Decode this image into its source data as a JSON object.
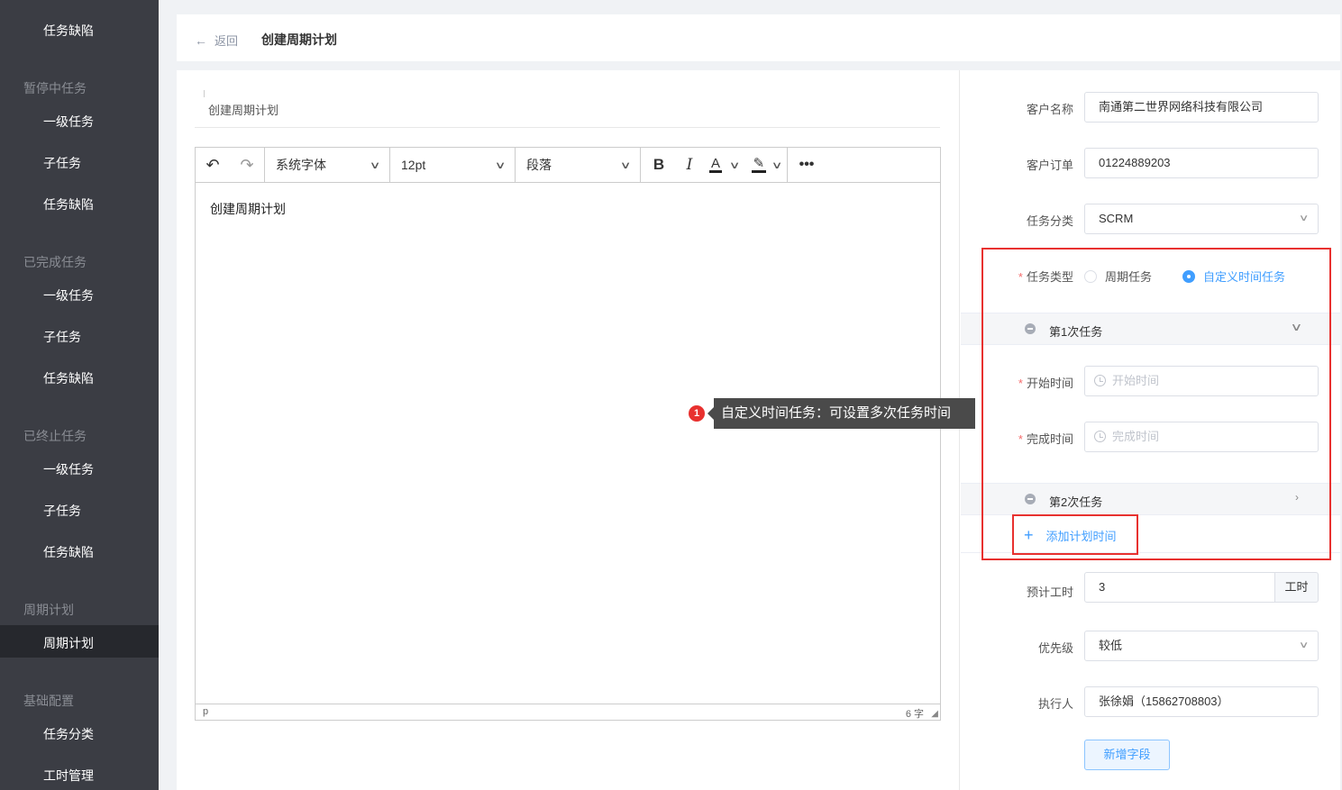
{
  "sidebar": {
    "items": [
      {
        "type": "item",
        "label": "任务缺陷"
      },
      {
        "type": "group",
        "label": "暂停中任务"
      },
      {
        "type": "item",
        "label": "一级任务"
      },
      {
        "type": "item",
        "label": "子任务"
      },
      {
        "type": "item",
        "label": "任务缺陷"
      },
      {
        "type": "group",
        "label": "已完成任务"
      },
      {
        "type": "item",
        "label": "一级任务"
      },
      {
        "type": "item",
        "label": "子任务"
      },
      {
        "type": "item",
        "label": "任务缺陷"
      },
      {
        "type": "group",
        "label": "已终止任务"
      },
      {
        "type": "item",
        "label": "一级任务"
      },
      {
        "type": "item",
        "label": "子任务"
      },
      {
        "type": "item",
        "label": "任务缺陷"
      },
      {
        "type": "group",
        "label": "周期计划"
      },
      {
        "type": "item",
        "label": "周期计划",
        "active": true
      },
      {
        "type": "group",
        "label": "基础配置"
      },
      {
        "type": "item",
        "label": "任务分类"
      },
      {
        "type": "item",
        "label": "工时管理"
      }
    ]
  },
  "header": {
    "back_label": "返回",
    "title": "创建周期计划"
  },
  "editor": {
    "title_value": "创建周期计划",
    "toolbar": {
      "font_family": "系统字体",
      "font_size": "12pt",
      "block_format": "段落"
    },
    "content": "创建周期计划",
    "status_path": "p",
    "word_count": "6 字"
  },
  "tooltip": {
    "badge": "1",
    "text": "自定义时间任务：可设置多次任务时间"
  },
  "form": {
    "customer_name_label": "客户名称",
    "customer_name_value": "南通第二世界网络科技有限公司",
    "customer_order_label": "客户订单",
    "customer_order_value": "01224889203",
    "task_category_label": "任务分类",
    "task_category_value": "SCRM",
    "task_type_label": "任务类型",
    "task_type_options": [
      "周期任务",
      "自定义时间任务"
    ],
    "task_type_selected": "自定义时间任务",
    "task1_label": "第1次任务",
    "start_time_label": "开始时间",
    "start_time_placeholder": "开始时间",
    "end_time_label": "完成时间",
    "end_time_placeholder": "完成时间",
    "task2_label": "第2次任务",
    "add_plan_label": "添加计划时间",
    "est_hours_label": "预计工时",
    "est_hours_value": "3",
    "est_hours_unit": "工时",
    "priority_label": "优先级",
    "priority_value": "较低",
    "assignee_label": "执行人",
    "assignee_value": "张徐娟（15862708803）",
    "add_field_button": "新增字段"
  },
  "colors": {
    "sidebar_bg": "#3b3d44",
    "sidebar_active_bg": "#26282d",
    "accent": "#409eff",
    "highlight_red": "#e8312f"
  }
}
